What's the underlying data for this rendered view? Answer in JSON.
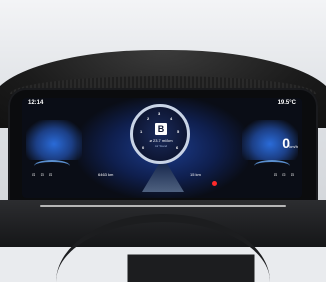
{
  "cluster": {
    "clock": "12:14",
    "outside_temp": "19.5°C",
    "gear": "B",
    "range": "ø 23.7 mi/km",
    "range_sub": "Air Stand",
    "speed": "0",
    "speed_unit": "km/h",
    "odometer": "6463 km",
    "fuel_range": "15 km",
    "rpm_ticks": [
      "0",
      "1",
      "2",
      "3",
      "4",
      "5",
      "6"
    ],
    "status_left": "⊡ ⊡ ⊡",
    "status_right": "⊡ ⊡ ⊡"
  },
  "colors": {
    "screen_bg": "#0a0d16",
    "accent_blue": "#2a6bd8",
    "warning_red": "#ff2a2a"
  }
}
